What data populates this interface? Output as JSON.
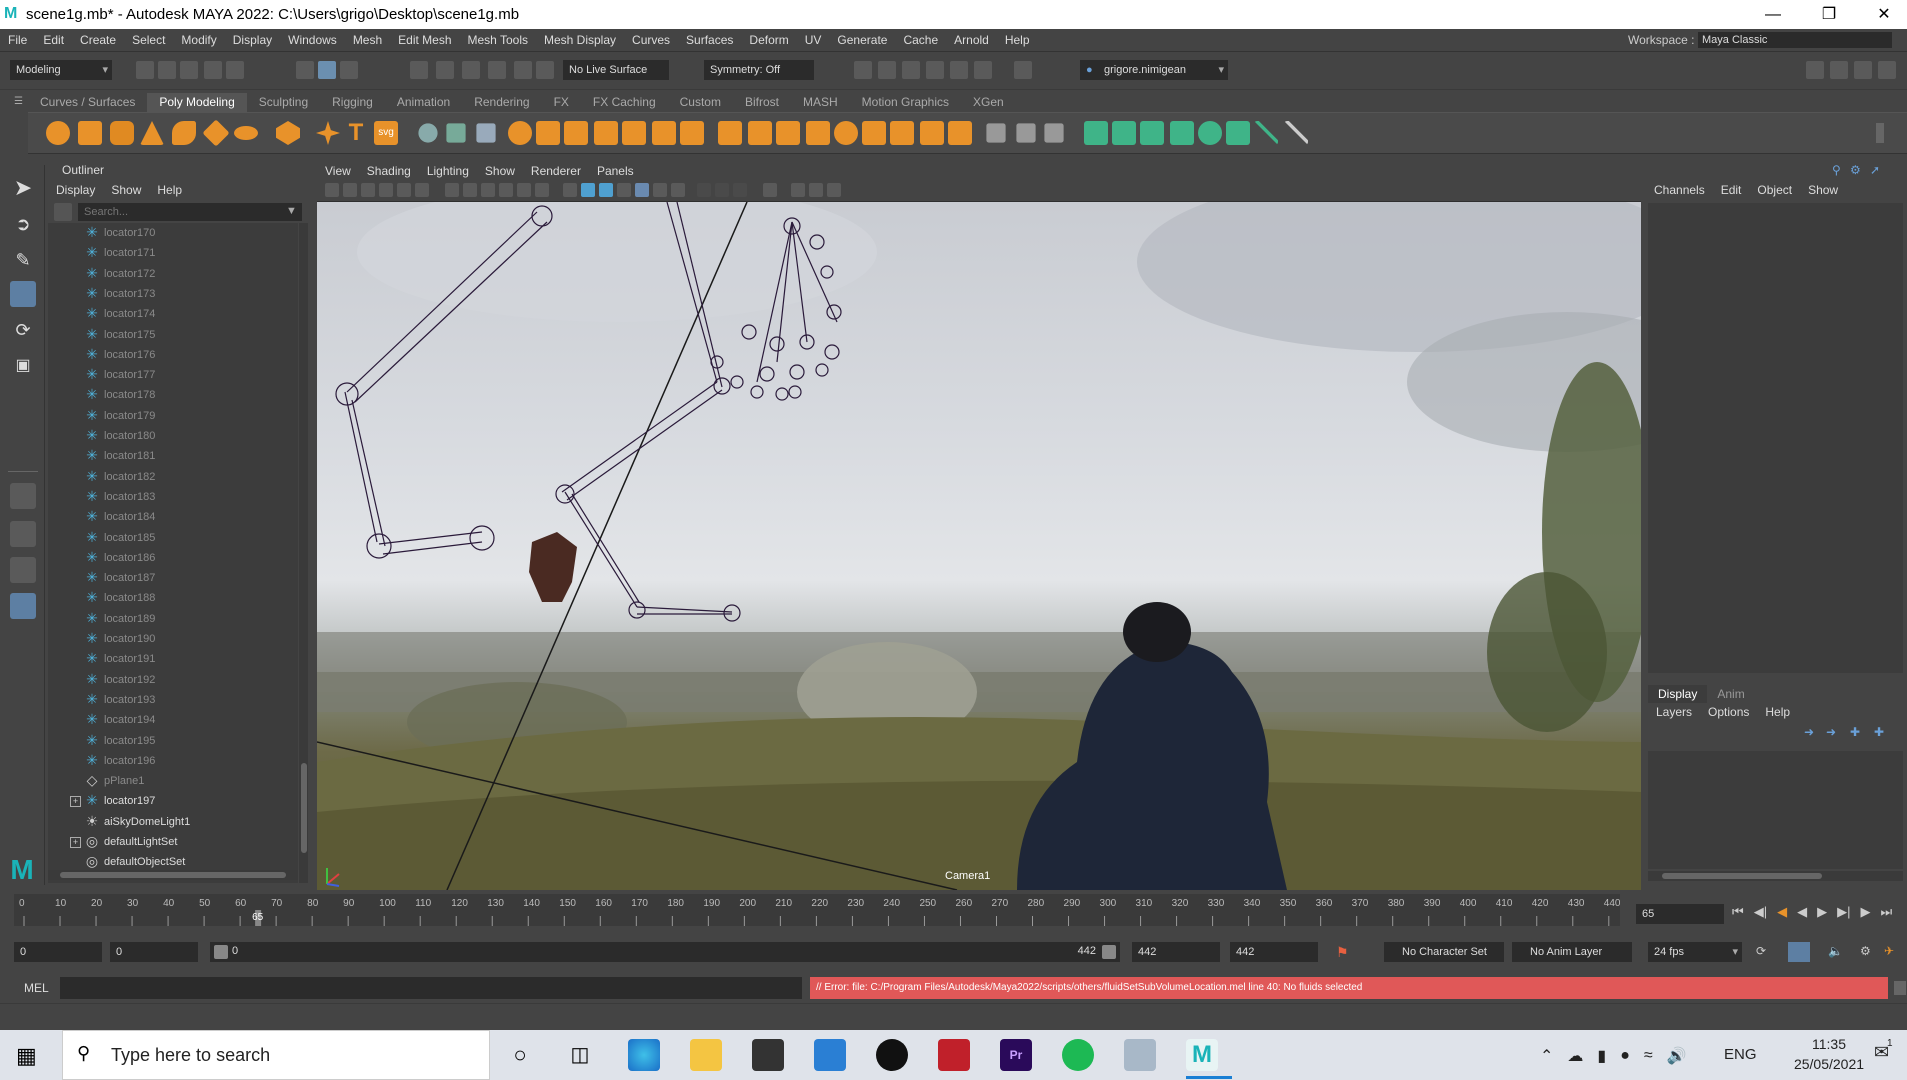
{
  "window": {
    "title": "scene1g.mb* - Autodesk MAYA 2022: C:\\Users\\grigo\\Desktop\\scene1g.mb",
    "logo": "M"
  },
  "menubar": {
    "items": [
      "File",
      "Edit",
      "Create",
      "Select",
      "Modify",
      "Display",
      "Windows",
      "Mesh",
      "Edit Mesh",
      "Mesh Tools",
      "Mesh Display",
      "Curves",
      "Surfaces",
      "Deform",
      "UV",
      "Generate",
      "Cache",
      "Arnold",
      "Help"
    ],
    "workspace_label": "Workspace :",
    "workspace_value": "Maya Classic"
  },
  "statusline": {
    "menuset": "Modeling",
    "live_surface": "No Live Surface",
    "symmetry": "Symmetry: Off",
    "user": "grigore.nimigean"
  },
  "shelf": {
    "tabs": [
      "Curves / Surfaces",
      "Poly Modeling",
      "Sculpting",
      "Rigging",
      "Animation",
      "Rendering",
      "FX",
      "FX Caching",
      "Custom",
      "Bifrost",
      "MASH",
      "Motion Graphics",
      "XGen"
    ],
    "active": "Poly Modeling",
    "svg_label": "svg",
    "text_label": "T"
  },
  "outliner": {
    "title": "Outliner",
    "menu": [
      "Display",
      "Show",
      "Help"
    ],
    "search_placeholder": "Search...",
    "items": [
      {
        "label": "locator170",
        "type": "locator",
        "dim": true
      },
      {
        "label": "locator171",
        "type": "locator",
        "dim": true
      },
      {
        "label": "locator172",
        "type": "locator",
        "dim": true
      },
      {
        "label": "locator173",
        "type": "locator",
        "dim": true
      },
      {
        "label": "locator174",
        "type": "locator",
        "dim": true
      },
      {
        "label": "locator175",
        "type": "locator",
        "dim": true
      },
      {
        "label": "locator176",
        "type": "locator",
        "dim": true
      },
      {
        "label": "locator177",
        "type": "locator",
        "dim": true
      },
      {
        "label": "locator178",
        "type": "locator",
        "dim": true
      },
      {
        "label": "locator179",
        "type": "locator",
        "dim": true
      },
      {
        "label": "locator180",
        "type": "locator",
        "dim": true
      },
      {
        "label": "locator181",
        "type": "locator",
        "dim": true
      },
      {
        "label": "locator182",
        "type": "locator",
        "dim": true
      },
      {
        "label": "locator183",
        "type": "locator",
        "dim": true
      },
      {
        "label": "locator184",
        "type": "locator",
        "dim": true
      },
      {
        "label": "locator185",
        "type": "locator",
        "dim": true
      },
      {
        "label": "locator186",
        "type": "locator",
        "dim": true
      },
      {
        "label": "locator187",
        "type": "locator",
        "dim": true
      },
      {
        "label": "locator188",
        "type": "locator",
        "dim": true
      },
      {
        "label": "locator189",
        "type": "locator",
        "dim": true
      },
      {
        "label": "locator190",
        "type": "locator",
        "dim": true
      },
      {
        "label": "locator191",
        "type": "locator",
        "dim": true
      },
      {
        "label": "locator192",
        "type": "locator",
        "dim": true
      },
      {
        "label": "locator193",
        "type": "locator",
        "dim": true
      },
      {
        "label": "locator194",
        "type": "locator",
        "dim": true
      },
      {
        "label": "locator195",
        "type": "locator",
        "dim": true
      },
      {
        "label": "locator196",
        "type": "locator",
        "dim": true
      },
      {
        "label": "pPlane1",
        "type": "plane",
        "dim": true
      },
      {
        "label": "locator197",
        "type": "locator",
        "dim": false,
        "expand": true
      },
      {
        "label": "aiSkyDomeLight1",
        "type": "light",
        "dim": false
      },
      {
        "label": "defaultLightSet",
        "type": "set",
        "dim": false,
        "expand": true
      },
      {
        "label": "defaultObjectSet",
        "type": "set",
        "dim": false
      }
    ]
  },
  "viewport": {
    "menu": [
      "View",
      "Shading",
      "Lighting",
      "Show",
      "Renderer",
      "Panels"
    ],
    "camera_label": "Camera1"
  },
  "channelbox": {
    "menu": [
      "Channels",
      "Edit",
      "Object",
      "Show"
    ],
    "layer_tabs": [
      "Display",
      "Anim"
    ],
    "layer_menu": [
      "Layers",
      "Options",
      "Help"
    ]
  },
  "timeline": {
    "ticks": [
      0,
      10,
      20,
      30,
      40,
      50,
      60,
      70,
      80,
      90,
      100,
      110,
      120,
      130,
      140,
      150,
      160,
      170,
      180,
      190,
      200,
      210,
      220,
      230,
      240,
      250,
      260,
      270,
      280,
      290,
      300,
      310,
      320,
      330,
      340,
      350,
      360,
      370,
      380,
      390,
      400,
      410,
      420,
      430,
      440
    ],
    "current_frame": 65,
    "current_frame_field": "65",
    "start_field": "0",
    "start_inner": "0",
    "range_start": "0",
    "range_end": "442",
    "end_inner": "442",
    "end_field": "442",
    "character_set": "No Character Set",
    "anim_layer": "No Anim Layer",
    "fps": "24 fps"
  },
  "command": {
    "lang": "MEL",
    "error": "// Error: file: C:/Program Files/Autodesk/Maya2022/scripts/others/fluidSetSubVolumeLocation.mel line 40: No fluids selected"
  },
  "taskbar": {
    "search_placeholder": "Type here to search",
    "language": "ENG",
    "time": "11:35",
    "date": "25/05/2021",
    "notifications": "1"
  },
  "colors": {
    "error_bg": "#e05858",
    "accent_teal": "#1ab3b8",
    "shelf_orange": "#e8922a",
    "shelf_green": "#3fb488",
    "rig_line": "#2a1a3a"
  }
}
